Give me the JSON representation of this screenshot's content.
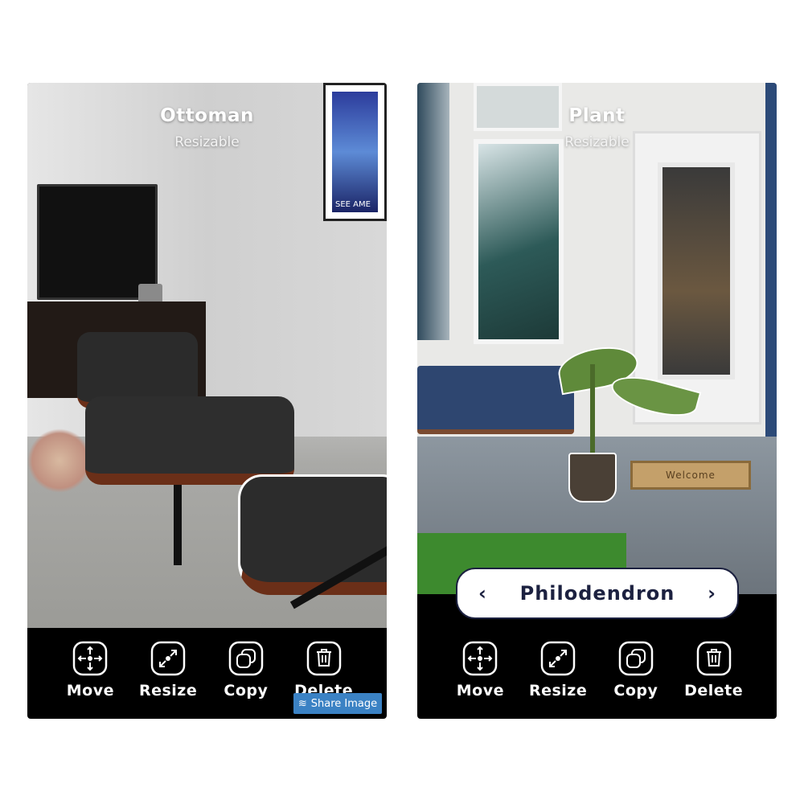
{
  "screens": [
    {
      "title": "Ottoman",
      "subtitle": "Resizable",
      "poster_text": "SEE AME",
      "toolbar": [
        {
          "label": "Move",
          "icon": "move-icon"
        },
        {
          "label": "Resize",
          "icon": "resize-icon"
        },
        {
          "label": "Copy",
          "icon": "copy-icon"
        },
        {
          "label": "Delete",
          "icon": "trash-icon"
        }
      ],
      "share_button": {
        "label": "Share Image",
        "icon": "layers-icon",
        "color": "#3b82c4"
      }
    },
    {
      "title": "Plant",
      "subtitle": "Resizable",
      "mat_text": "Welcome",
      "selector": {
        "value": "Philodendron",
        "prev_icon": "chevron-left-icon",
        "next_icon": "chevron-right-icon"
      },
      "toolbar": [
        {
          "label": "Move",
          "icon": "move-icon"
        },
        {
          "label": "Resize",
          "icon": "resize-icon"
        },
        {
          "label": "Copy",
          "icon": "copy-icon"
        },
        {
          "label": "Delete",
          "icon": "trash-icon"
        }
      ]
    }
  ],
  "colors": {
    "toolbar_bg": "#000000",
    "selector_text": "#1c2140"
  }
}
